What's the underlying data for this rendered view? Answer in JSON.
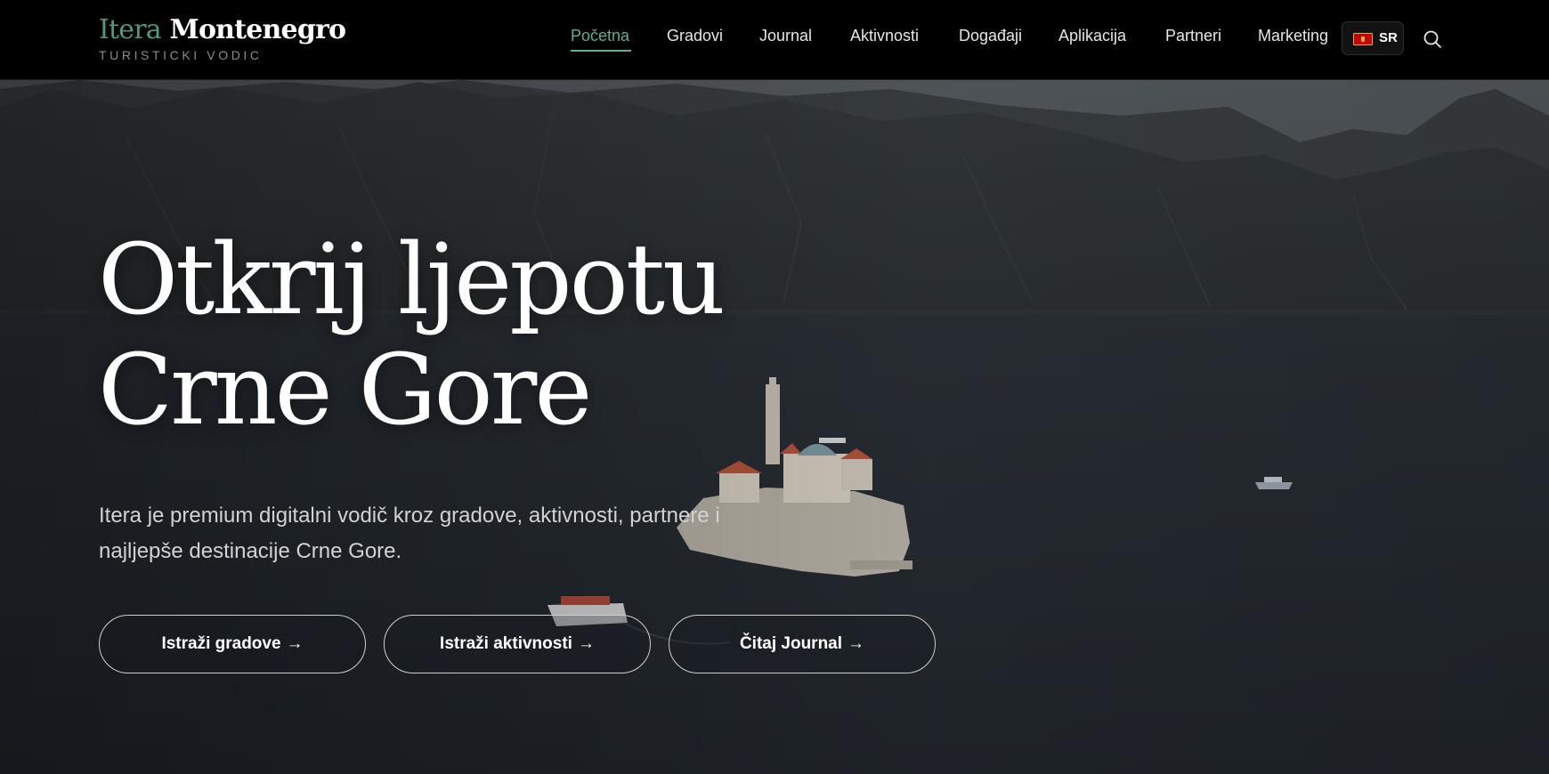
{
  "logo": {
    "brand": "Itera",
    "country": "Montenegro",
    "tagline": "TURISTICKI VODIC"
  },
  "nav": {
    "items": [
      {
        "label": "Početna",
        "active": true
      },
      {
        "label": "Gradovi",
        "active": false
      },
      {
        "label": "Journal",
        "active": false
      },
      {
        "label": "Aktivnosti",
        "active": false
      },
      {
        "label": "Događaji",
        "active": false
      },
      {
        "label": "Aplikacija",
        "active": false
      },
      {
        "label": "Partneri",
        "active": false
      },
      {
        "label": "Marketing",
        "active": false
      }
    ]
  },
  "language": {
    "code": "SR",
    "flag_icon": "montenegro-flag-icon"
  },
  "search": {
    "icon": "search-icon"
  },
  "hero": {
    "title_line1": "Otkrij ljepotu",
    "title_line2": "Crne Gore",
    "description": "Itera je premium digitalni vodič kroz gradove, aktivnosti, partnere i najljepše destinacije Crne Gore.",
    "buttons": [
      {
        "label": "Istraži gradove",
        "arrow": "→"
      },
      {
        "label": "Istraži aktivnosti",
        "arrow": "→"
      },
      {
        "label": "Čitaj Journal",
        "arrow": "→"
      }
    ]
  },
  "colors": {
    "accent": "#5fae8c",
    "header_bg": "#000000",
    "text": "#ffffff"
  }
}
